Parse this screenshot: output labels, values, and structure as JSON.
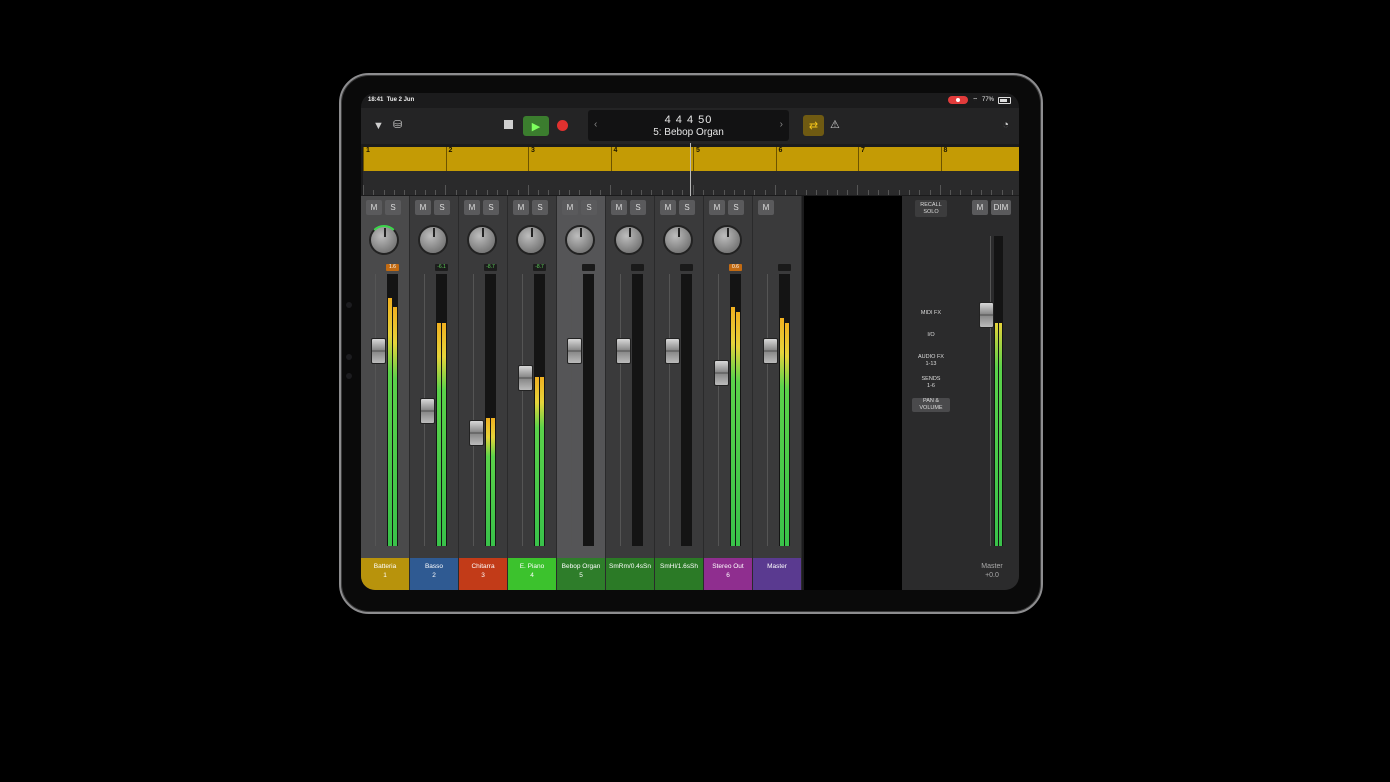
{
  "status": {
    "time": "18:41",
    "date": "Tue 2 Jun",
    "battery": "77%"
  },
  "toolbar": {
    "menu_icon": "chevron-down-icon",
    "browser_icon": "browser-icon",
    "stop_icon": "stop-icon",
    "play_icon": "play-icon",
    "record_icon": "record-icon",
    "cycle_icon": "cycle-icon",
    "metronome_icon": "metronome-icon",
    "settings_icon": "settings-icon"
  },
  "lcd": {
    "position": "4 4 4  50",
    "track": "5: Bebop Organ"
  },
  "ruler": {
    "bars": [
      "1",
      "2",
      "3",
      "4",
      "5",
      "6",
      "7",
      "8"
    ]
  },
  "colors": {
    "accent": "#c49b05",
    "play": "#3b7d2e",
    "record": "#e0312f"
  },
  "channels": [
    {
      "name": "Batteria",
      "num": "1",
      "color": "#b8930c",
      "peak": "1.6",
      "peak_style": "orange",
      "mute": "M",
      "solo": "S",
      "meter_l": 0.91,
      "meter_r": 0.88,
      "fader": 0.72
    },
    {
      "name": "Basso",
      "num": "2",
      "color": "#2f5a92",
      "peak": "-6.1",
      "peak_style": "dark",
      "mute": "M",
      "solo": "S",
      "meter_l": 0.82,
      "meter_r": 0.82,
      "fader": 0.5
    },
    {
      "name": "Chitarra",
      "num": "3",
      "color": "#c23b18",
      "peak": "-8.7",
      "peak_style": "dark",
      "mute": "M",
      "solo": "S",
      "meter_l": 0.47,
      "meter_r": 0.47,
      "fader": 0.42
    },
    {
      "name": "E. Piano",
      "num": "4",
      "color": "#3cc22d",
      "peak": "-8.7",
      "peak_style": "dark",
      "mute": "M",
      "solo": "S",
      "meter_l": 0.62,
      "meter_r": 0.62,
      "fader": 0.62
    },
    {
      "name": "Bebop Organ",
      "num": "5",
      "color": "#2e7d2a",
      "peak": "",
      "peak_style": "blank",
      "mute": "M",
      "solo": "S",
      "meter_l": 0,
      "meter_r": 0,
      "fader": 0.72
    },
    {
      "name": "SmRm/0.4sSn",
      "num": "",
      "color": "#2b7a26",
      "peak": "",
      "peak_style": "blank",
      "mute": "M",
      "solo": "S",
      "meter_l": 0,
      "meter_r": 0,
      "fader": 0.72
    },
    {
      "name": "SmHl/1.6sSh",
      "num": "",
      "color": "#2b7a26",
      "peak": "",
      "peak_style": "blank",
      "mute": "M",
      "solo": "S",
      "meter_l": 0,
      "meter_r": 0,
      "fader": 0.72
    },
    {
      "name": "Stereo Out",
      "num": "6",
      "color": "#8f2e8f",
      "peak": "0.6",
      "peak_style": "orange",
      "mute": "M",
      "solo": "S",
      "meter_l": 0.88,
      "meter_r": 0.86,
      "fader": 0.64
    },
    {
      "name": "Master",
      "num": "",
      "color": "#5a3a90",
      "peak": "",
      "peak_style": "blank",
      "mute": "M",
      "solo": "",
      "meter_l": 0.84,
      "meter_r": 0.82,
      "fader": 0.72
    }
  ],
  "panel": {
    "recall_solo": "RECALL\nSOLO",
    "menu": [
      {
        "label": "MIDI FX",
        "active": false
      },
      {
        "label": "I/O",
        "active": false
      },
      {
        "label": "AUDIO FX\n1-13",
        "active": false
      },
      {
        "label": "SENDS\n1-6",
        "active": false
      },
      {
        "label": "PAN &\nVOLUME",
        "active": true
      }
    ],
    "master_mute": "M",
    "dim": "DIM",
    "master_label": "Master",
    "master_value": "+0.0",
    "meter_l": 0.9,
    "meter_r": 0.9,
    "fader": 0.75
  }
}
